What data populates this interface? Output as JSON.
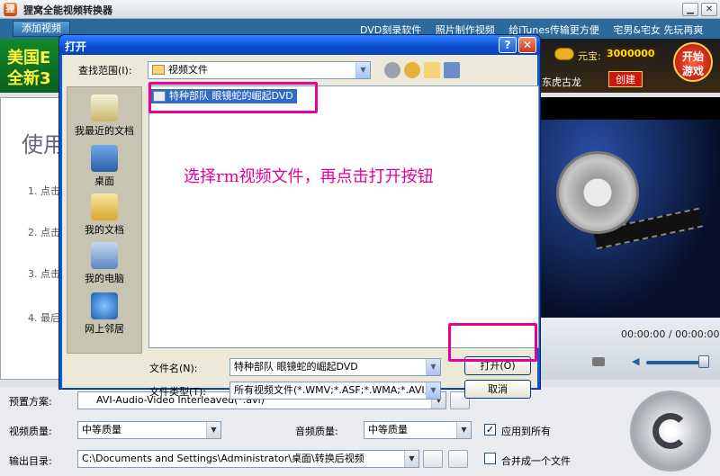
{
  "app": {
    "title": "狸窝全能视频转换器",
    "logo_glyph": "狸",
    "minimize_glyph": "▁",
    "close_glyph": "✕",
    "add_video_label": "添加视频",
    "toolbar_links": [
      "DVD刻录软件",
      "照片制作视频",
      "给iTunes传输更方便",
      "宅男&宅女 先玩再爽"
    ]
  },
  "ads": {
    "left_line1": "美国E",
    "left_line2": "全新3",
    "bao_label": "元宝:",
    "bao_value": "3000000",
    "right_text": "东虎古龙",
    "create_label": "创建",
    "game_label": "开始 游戏"
  },
  "main_panel": {
    "title": "使用",
    "steps": [
      "1. 点击",
      "2. 点击",
      "3. 点击",
      "4. 最后"
    ]
  },
  "preview": {
    "time": "00:00:00 / 00:00:00",
    "volume_glyph": "◀"
  },
  "bottom": {
    "preset_label": "预置方案:",
    "preset_value": "AVI-Audio-Video Interleaved(*.avi)",
    "video_quality_label": "视频质量:",
    "video_quality_value": "中等质量",
    "audio_quality_label": "音频质量:",
    "audio_quality_value": "中等质量",
    "apply_all_label": "应用到所有",
    "apply_all_checked": true,
    "output_label": "输出目录:",
    "output_value": "C:\\Documents and Settings\\Administrator\\桌面\\转换后视频",
    "merge_label": "合并成一个文件",
    "merge_checked": false,
    "check_glyph": "✓",
    "dropdown_glyph": "▼"
  },
  "dialog": {
    "title": "打开",
    "help_glyph": "?",
    "close_glyph": "✕",
    "lookin_label": "查找范围(I):",
    "lookin_value": "视频文件",
    "dropdown_glyph": "▼",
    "places": [
      "我最近的文档",
      "桌面",
      "我的文档",
      "我的电脑",
      "网上邻居"
    ],
    "files": [
      "特种部队 眼镜蛇的崛起DVD"
    ],
    "filename_label": "文件名(N):",
    "filename_value": "特种部队 眼镜蛇的崛起DVD",
    "filetype_label": "文件类型(T):",
    "filetype_value": "所有视频文件(*.WMV;*.ASF;*.WMA;*.AVI;",
    "open_button": "打开(O)",
    "cancel_button": "取消"
  },
  "annotation": {
    "text": "选择rm视频文件，再点击打开按钮",
    "color": "#e6009a"
  }
}
